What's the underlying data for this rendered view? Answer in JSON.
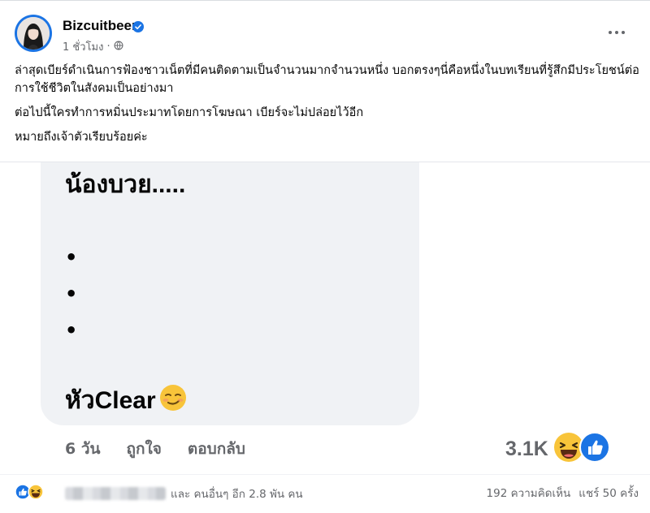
{
  "post": {
    "author": "Bizcuitbeer",
    "time": "1 ชั่วโมง",
    "privacy_icon": "globe-icon",
    "verified_icon": "verified-badge-icon",
    "caption": [
      "ล่าสุดเบียร์ดำเนินการฟ้องชาวเน็ตที่มีคนติดตามเป็นจำนวนมากจำนวนหนึ่ง บอกตรงๆนี่คือหนึ่งในบทเรียนที่รู้สึกมีประโยชน์ต่อการใช้ชีวิตในสังคมเป็นอย่างมา",
      "ต่อไปนี้ใครทำการหมิ่นประมาทโดยการโฆษณา เบียร์จะไม่ปล่อยไว้อีก",
      "หมายถึงเจ้าตัวเรียบร้อยค่ะ"
    ]
  },
  "comment_image": {
    "title": "น้องบวย.....",
    "dots": [
      "•",
      "•",
      "•"
    ],
    "last_line": "หัวClear",
    "meta": {
      "time": "6 วัน",
      "like": "ถูกใจ",
      "reply": "ตอบกลับ"
    },
    "reaction_count": "3.1K",
    "reaction_icons": [
      "haha-icon",
      "like-icon"
    ]
  },
  "summary": {
    "others_text": "และ คนอื่นๆ อีก 2.8 พัน คน",
    "comments": "192 ความคิดเห็น",
    "shares": "แชร์ 50 ครั้ง"
  },
  "colors": {
    "accent": "#1b74e4",
    "text_secondary": "#65676b",
    "bubble_bg": "#f0f2f5"
  }
}
